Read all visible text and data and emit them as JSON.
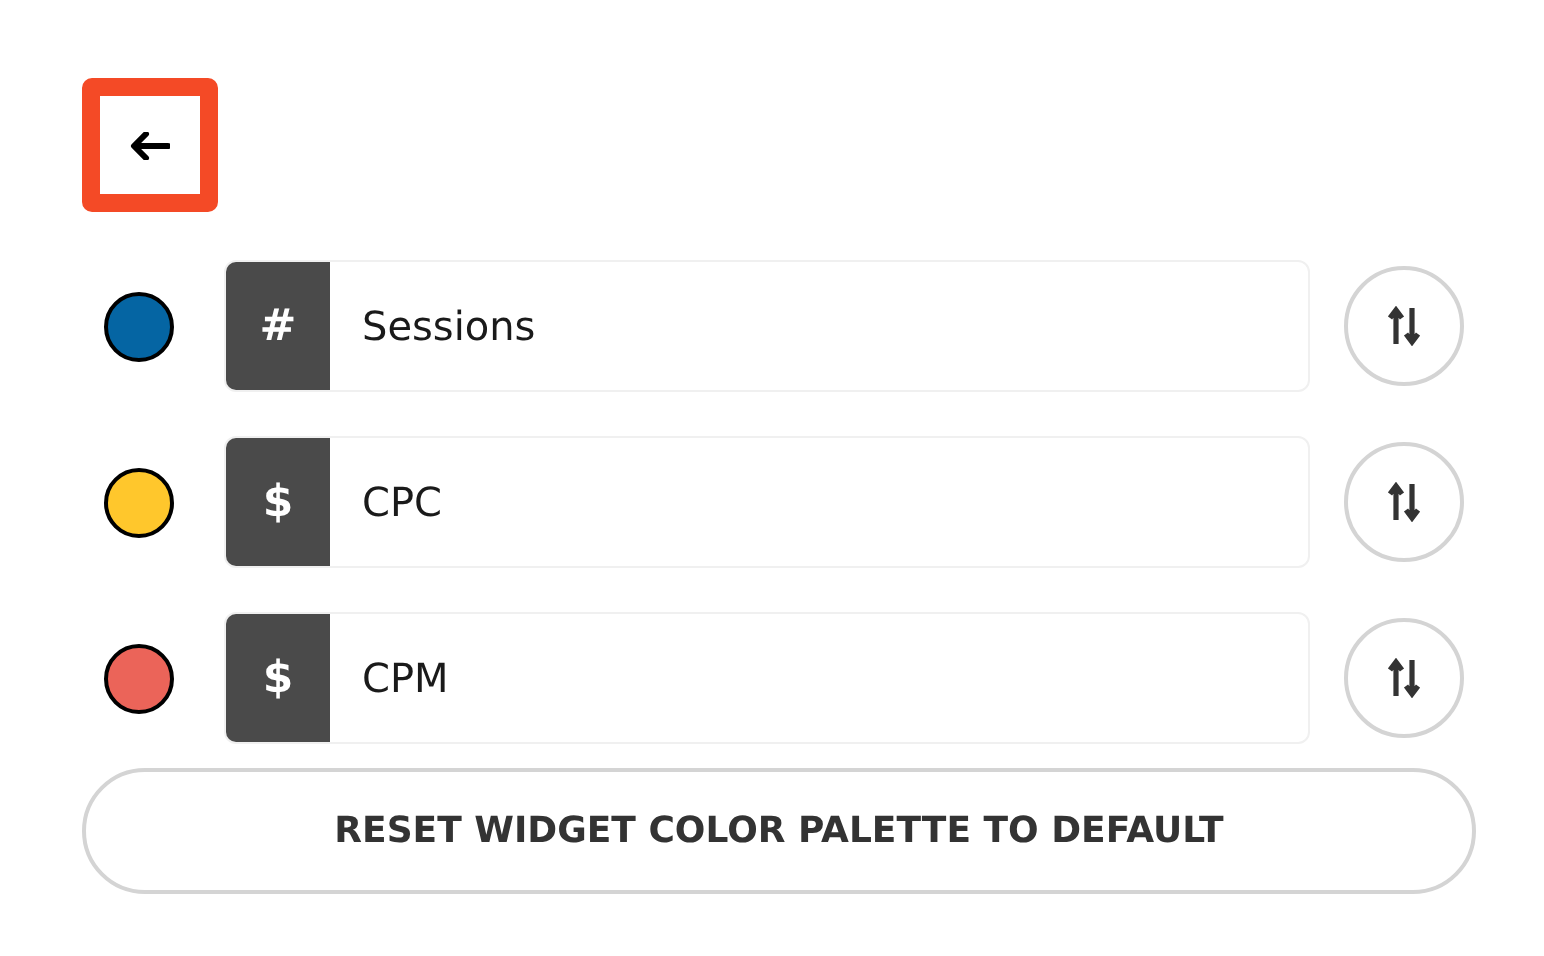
{
  "metrics": [
    {
      "color": "#0565a3",
      "symbol": "#",
      "name": "Sessions"
    },
    {
      "color": "#ffc72c",
      "symbol": "$",
      "name": "CPC"
    },
    {
      "color": "#eb6459",
      "symbol": "$",
      "name": "CPM"
    }
  ],
  "reset_button": "RESET WIDGET COLOR PALETTE TO DEFAULT"
}
